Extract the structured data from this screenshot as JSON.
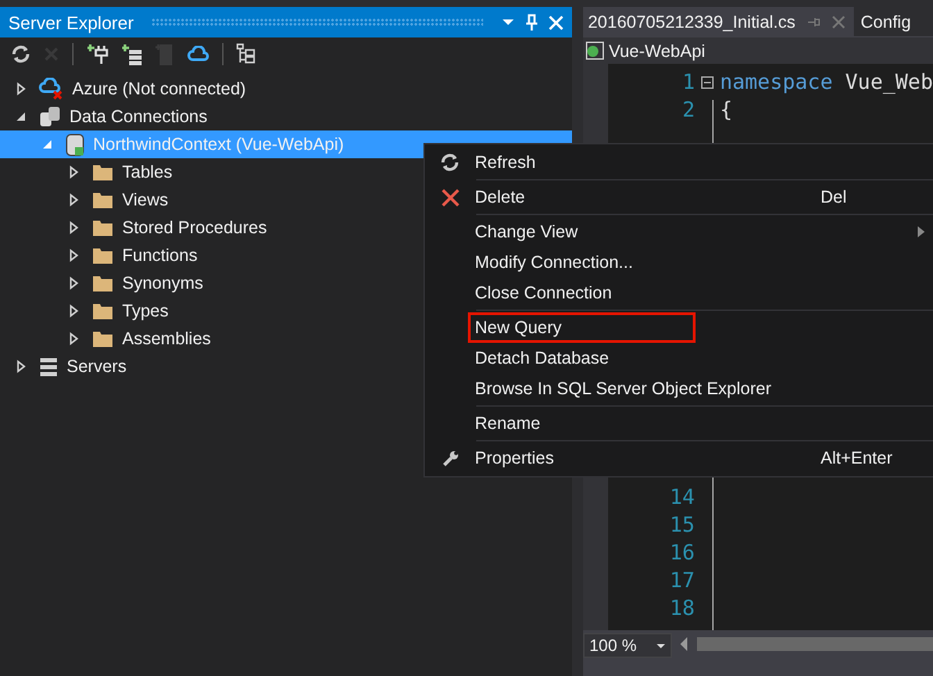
{
  "server_explorer": {
    "title": "Server Explorer",
    "toolbar": [
      {
        "kind": "refresh",
        "disabled": false
      },
      {
        "kind": "delete",
        "disabled": true
      },
      {
        "kind": "separator"
      },
      {
        "kind": "add-connection",
        "disabled": false
      },
      {
        "kind": "add-server",
        "disabled": false
      },
      {
        "kind": "server",
        "disabled": true
      },
      {
        "kind": "cloud",
        "disabled": false
      },
      {
        "kind": "separator"
      },
      {
        "kind": "tree",
        "disabled": false
      }
    ],
    "tree": [
      {
        "label": "Azure (Not connected)",
        "kind": "azure",
        "expanded": false,
        "selected": false
      },
      {
        "label": "Data Connections",
        "kind": "connections",
        "expanded": true,
        "selected": false,
        "children": [
          {
            "label": "NorthwindContext (Vue-WebApi)",
            "kind": "database",
            "expanded": true,
            "selected": true,
            "children": [
              {
                "label": "Tables",
                "kind": "folder",
                "expanded": false,
                "selected": false
              },
              {
                "label": "Views",
                "kind": "folder",
                "expanded": false,
                "selected": false
              },
              {
                "label": "Stored Procedures",
                "kind": "folder",
                "expanded": false,
                "selected": false
              },
              {
                "label": "Functions",
                "kind": "folder",
                "expanded": false,
                "selected": false
              },
              {
                "label": "Synonyms",
                "kind": "folder",
                "expanded": false,
                "selected": false
              },
              {
                "label": "Types",
                "kind": "folder",
                "expanded": false,
                "selected": false
              },
              {
                "label": "Assemblies",
                "kind": "folder",
                "expanded": false,
                "selected": false
              }
            ]
          }
        ]
      },
      {
        "label": "Servers",
        "kind": "servers",
        "expanded": false,
        "selected": false
      }
    ]
  },
  "editor": {
    "tabs": [
      {
        "label": "20160705212339_Initial.cs",
        "selected": true
      },
      {
        "label": "Config",
        "selected": false
      }
    ],
    "navigation": "Vue-WebApi",
    "code_top": [
      {
        "number": "1",
        "tokens": [
          {
            "text": "namespace",
            "kind": "keyword"
          },
          {
            "text": " Vue_Web",
            "kind": "plain"
          }
        ]
      },
      {
        "number": "2",
        "tokens": [
          {
            "text": "{",
            "kind": "plain"
          }
        ]
      }
    ],
    "code_bottom": [
      {
        "number": "14"
      },
      {
        "number": "15"
      },
      {
        "number": "16"
      },
      {
        "number": "17"
      },
      {
        "number": "18"
      }
    ],
    "zoom": "100 %"
  },
  "context_menu": [
    {
      "label": "Refresh",
      "kind": "refresh",
      "highlighted": false,
      "submenu": false
    },
    {
      "kind": "separator"
    },
    {
      "label": "Delete",
      "kind": "delete",
      "shortcut": "Del",
      "highlighted": false,
      "submenu": false
    },
    {
      "kind": "separator"
    },
    {
      "label": "Change View",
      "kind": "plain",
      "highlighted": false,
      "submenu": true
    },
    {
      "label": "Modify Connection...",
      "kind": "plain",
      "highlighted": false,
      "submenu": false
    },
    {
      "label": "Close Connection",
      "kind": "plain",
      "highlighted": false,
      "submenu": false
    },
    {
      "kind": "separator"
    },
    {
      "label": "New Query",
      "kind": "plain",
      "highlighted": true,
      "submenu": false
    },
    {
      "label": "Detach Database",
      "kind": "plain",
      "highlighted": false,
      "submenu": false
    },
    {
      "label": "Browse In SQL Server Object Explorer",
      "kind": "plain",
      "highlighted": false,
      "submenu": false
    },
    {
      "kind": "separator"
    },
    {
      "label": "Rename",
      "kind": "plain",
      "highlighted": false,
      "submenu": false
    },
    {
      "kind": "separator"
    },
    {
      "label": "Properties",
      "kind": "properties",
      "shortcut": "Alt+Enter",
      "highlighted": false,
      "submenu": false
    }
  ]
}
